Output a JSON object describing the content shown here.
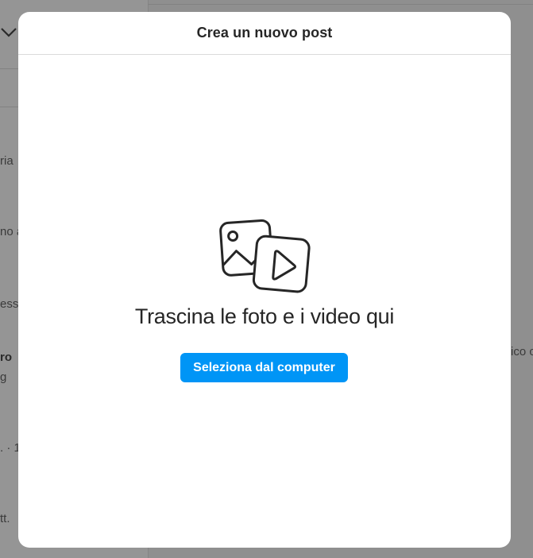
{
  "background": {
    "fragments": [
      {
        "id": "a",
        "text": "ria"
      },
      {
        "id": "b",
        "text": "no a"
      },
      {
        "id": "c",
        "text": "ess"
      },
      {
        "id": "d",
        "text": "ro"
      },
      {
        "id": "e",
        "text": "g"
      },
      {
        "id": "f",
        "text": ". · 1"
      },
      {
        "id": "g",
        "text": "tt."
      },
      {
        "id": "h",
        "text": "ico c"
      }
    ]
  },
  "modal": {
    "title": "Crea un nuovo post",
    "drop_text": "Trascina le foto e i video qui",
    "select_button_label": "Seleziona dal computer",
    "accent_color": "#0095f6",
    "icon": "photo-video-icon"
  }
}
